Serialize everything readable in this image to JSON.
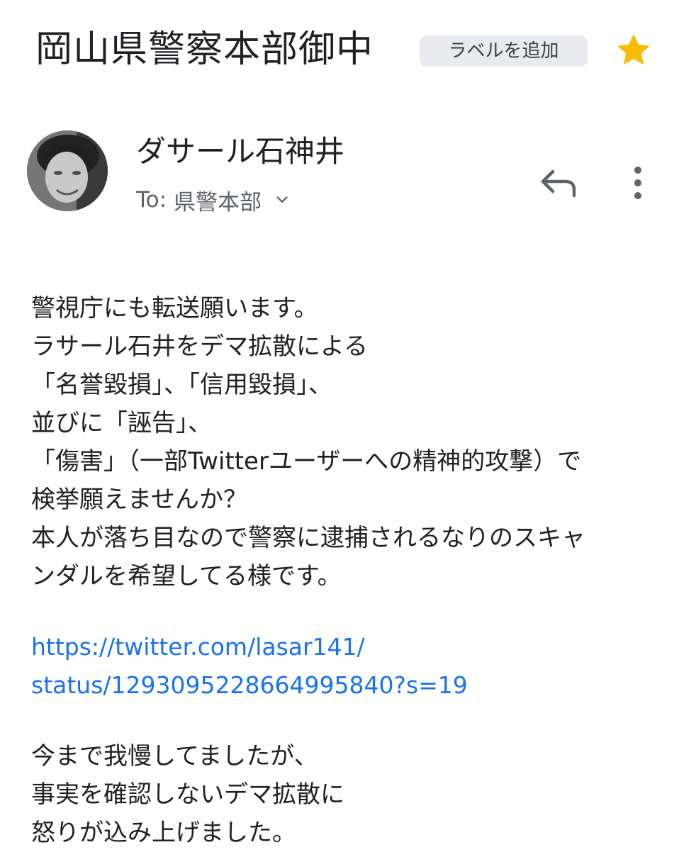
{
  "header": {
    "subject": "岡山県警察本部御中",
    "label_chip": "ラベルを追加",
    "star_icon": "star-icon",
    "star_color": "#f9bc05"
  },
  "message": {
    "sender_name": "ダサール石神井",
    "recipient_prefix": "To:",
    "recipient": "県警本部",
    "reply_icon": "reply-icon",
    "more_icon": "more-vertical-icon",
    "avatar_icon": "avatar-photo"
  },
  "body": {
    "paragraph1": [
      "警視庁にも転送願います。",
      "ラサール石井をデマ拡散による",
      "「名誉毀損」、「信用毀損」、",
      "並びに「誣告」、",
      "「傷害」（一部Twitterユーザーへの精神的攻撃）で",
      "検挙願えませんか？",
      "本人が落ち目なので警察に逮捕されるなりのスキャ",
      "ンダルを希望してる様です。"
    ],
    "link": [
      "https://twitter.com/lasar141/",
      "status/1293095228664995840?s=19"
    ],
    "paragraph2": [
      "今まで我慢してましたが、",
      "事実を確認しないデマ拡散に",
      "怒りが込み上げました。"
    ]
  },
  "colors": {
    "link": "#1a73e8",
    "chip_bg": "#e8eaed",
    "text": "#202124",
    "secondary_text": "#5f6368"
  }
}
